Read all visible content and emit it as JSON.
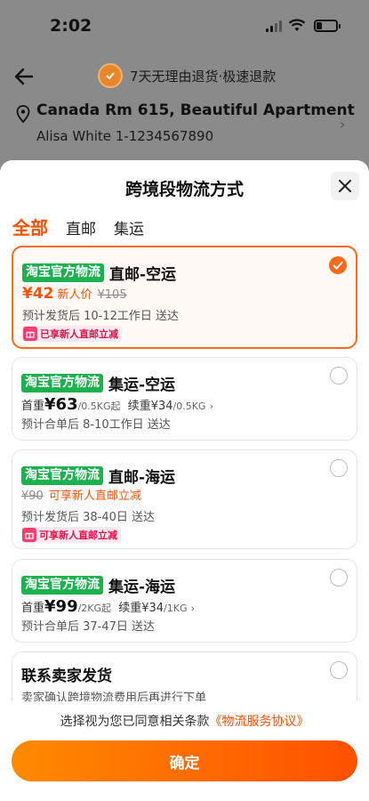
{
  "status_bar": {
    "time": "2:02"
  },
  "background_page": {
    "promo_text": "7天无理由退货·极速退款",
    "address_line1": "Canada  Rm 615, Beautiful Apartment",
    "address_line2": "Alisa White  1-1234567890"
  },
  "sheet": {
    "title": "跨境段物流方式",
    "tabs": [
      {
        "label": "全部",
        "active": true
      },
      {
        "label": "直邮",
        "active": false
      },
      {
        "label": "集运",
        "active": false
      }
    ],
    "options": [
      {
        "brand": "淘宝官方物流",
        "method": "直邮-空运",
        "price": "¥42",
        "new_user": "新人价",
        "original": "¥105",
        "eta": "预计发货后 10-12工作日 送达",
        "promo": "已享新人直邮立减",
        "selected": true
      },
      {
        "brand": "淘宝官方物流",
        "method": "集运-空运",
        "first_label": "首重",
        "first_price": "¥63",
        "first_unit": "/0.5KG起",
        "cont_label": "续重",
        "cont_price": "¥34",
        "cont_unit": "/0.5KG",
        "eta": "预计合单后 8-10工作日 送达",
        "selected": false
      },
      {
        "brand": "淘宝官方物流",
        "method": "直邮-海运",
        "original": "¥90",
        "note": "可享新人直邮立减",
        "eta": "预计发货后 38-40日 送达",
        "promo": "可享新人直邮立减",
        "selected": false
      },
      {
        "brand": "淘宝官方物流",
        "method": "集运-海运",
        "first_label": "首重",
        "first_price": "¥99",
        "first_unit": "/2KG起",
        "cont_label": "续重",
        "cont_price": "¥34",
        "cont_unit": "/1KG",
        "eta": "预计合单后 37-47日 送达",
        "selected": false
      },
      {
        "method": "联系卖家发货",
        "desc": "卖家确认跨境物流费用后再进行下单",
        "selected": false
      }
    ],
    "agreement_text": "选择视为您已同意相关条款",
    "agreement_link": "《物流服务协议》",
    "confirm_label": "确定"
  },
  "colors": {
    "accent": "#ff5000",
    "brand_green": "#1db04f",
    "selected_border": "#ff6a1a"
  }
}
